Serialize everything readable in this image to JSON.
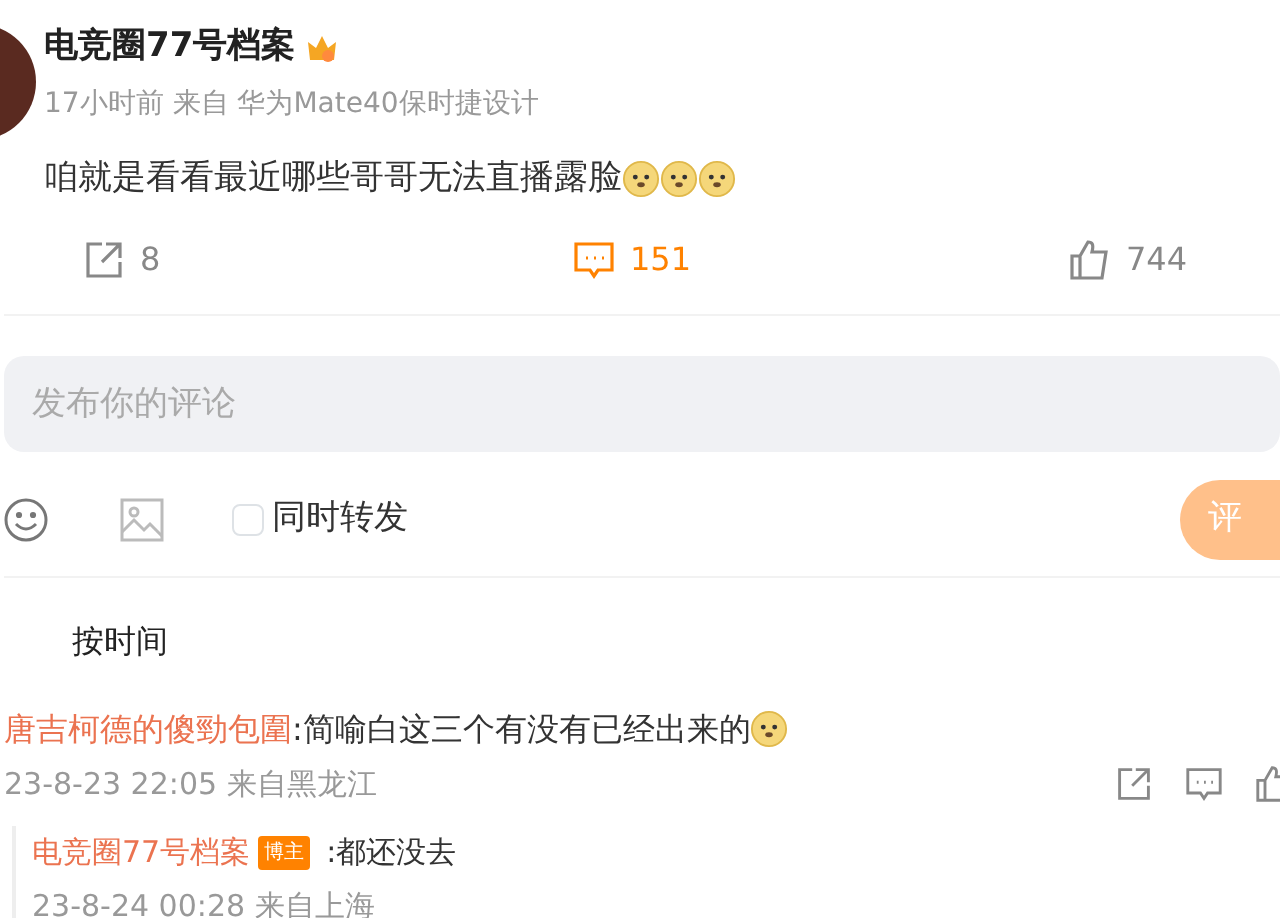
{
  "post": {
    "author": "电竞圈77号档案",
    "meta": "17小时前 来自 华为Mate40保时捷设计",
    "text": "咱就是看看最近哪些哥哥无法直播露脸",
    "emojis": [
      {
        "kind": "doge"
      },
      {
        "kind": "doge"
      },
      {
        "kind": "doge"
      }
    ],
    "reposts": "8",
    "comments": "151",
    "likes": "744"
  },
  "composer": {
    "placeholder": "发布你的评论",
    "repost_checked": false,
    "repost_label": "同时转发",
    "submit": "评"
  },
  "sort": "按时间",
  "comments": [
    {
      "author": "唐吉柯德的傻勁包圍",
      "text": ":简喻白这三个有没有已经出来的",
      "emojis": [
        {
          "kind": "doge"
        }
      ],
      "meta": "23-8-23 22:05 来自黑龙江",
      "replies": [
        {
          "author": "电竞圈77号档案",
          "badge": "博主",
          "text": ":都还没去",
          "meta": "23-8-24 00:28 来自上海"
        }
      ]
    }
  ]
}
